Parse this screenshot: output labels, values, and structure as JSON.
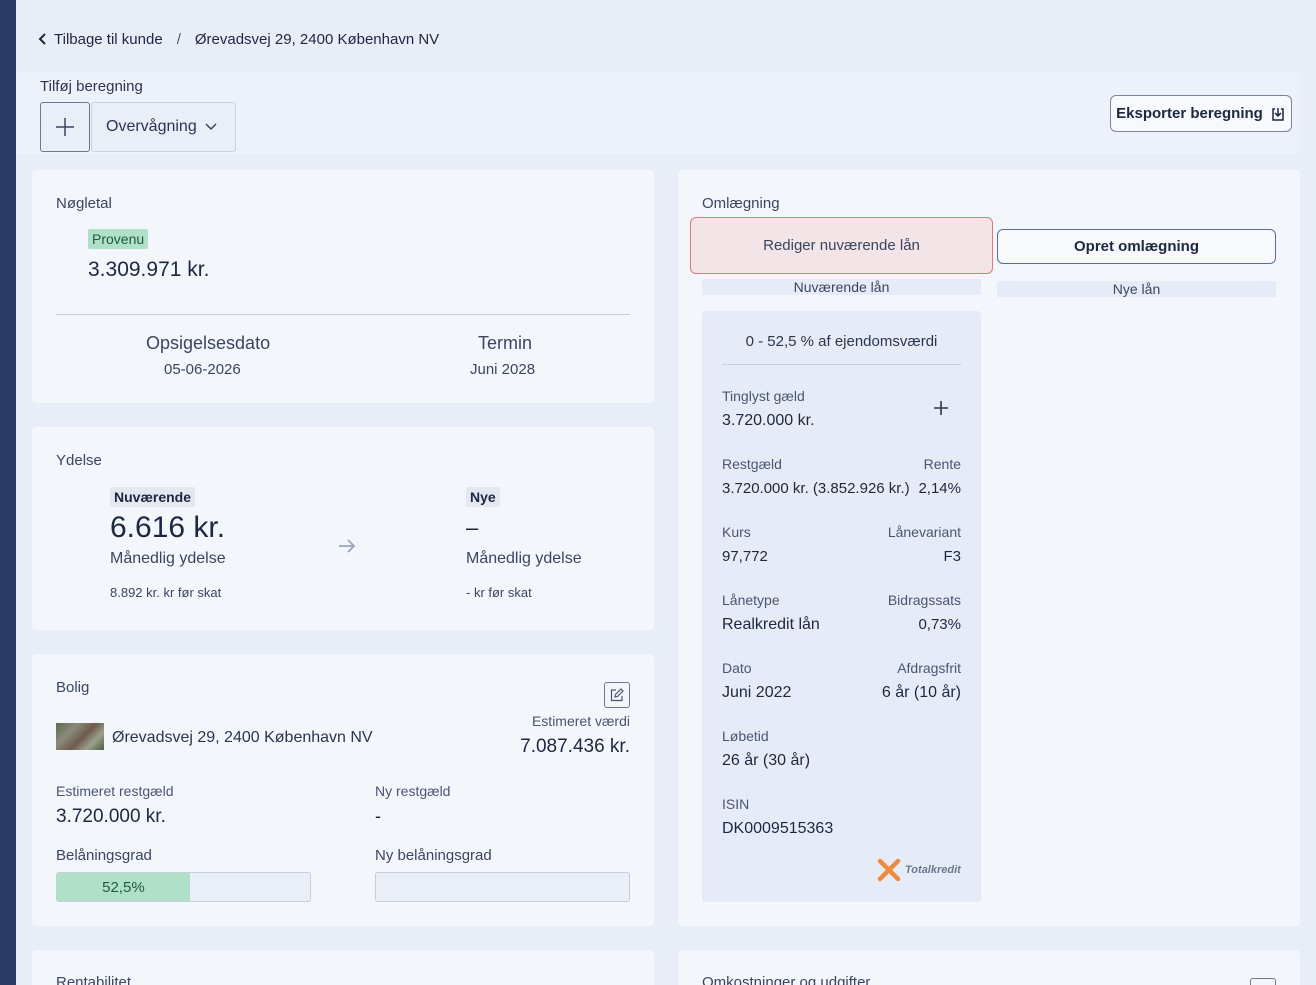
{
  "breadcrumb": {
    "back": "Tilbage til kunde",
    "separator": "/",
    "address": "Ørevadsvej 29, 2400 København NV"
  },
  "toolbar": {
    "add_label": "Tilføj beregning",
    "dropdown_value": "Overvågning",
    "export_label": "Eksporter beregning"
  },
  "noegletal": {
    "title": "Nøgletal",
    "badge": "Provenu",
    "amount": "3.309.971 kr.",
    "opsigelse_label": "Opsigelsesdato",
    "opsigelse_value": "05-06-2026",
    "termin_label": "Termin",
    "termin_value": "Juni 2028"
  },
  "ydelse": {
    "title": "Ydelse",
    "current_badge": "Nuværende",
    "current_amount": "6.616 kr.",
    "current_sub": "Månedlig ydelse",
    "current_pretax": "8.892 kr. kr før skat",
    "new_badge": "Nye",
    "new_amount": "–",
    "new_sub": "Månedlig ydelse",
    "new_pretax": "- kr før skat"
  },
  "bolig": {
    "title": "Bolig",
    "address": "Ørevadsvej 29, 2400 København NV",
    "est_value_label": "Estimeret værdi",
    "est_value": "7.087.436 kr.",
    "restgaeld_label": "Estimeret restgæld",
    "restgaeld_value": "3.720.000 kr.",
    "ny_restgaeld_label": "Ny restgæld",
    "ny_restgaeld_value": "-",
    "belaaning_label": "Belåningsgrad",
    "belaaning_value": "52,5%",
    "belaaning_fraction": 0.525,
    "ny_belaaning_label": "Ny belåningsgrad"
  },
  "rentabilitet": {
    "title": "Rentabilitet"
  },
  "omlaegning": {
    "title": "Omlægning",
    "edit_button": "Rediger nuværende lån",
    "create_button": "Opret omlægning",
    "current_tab": "Nuværende lån",
    "new_tab": "Nye lån"
  },
  "loan": {
    "range": "0 - 52,5 % af ejendomsværdi",
    "tinglyst_label": "Tinglyst gæld",
    "tinglyst_value": "3.720.000 kr.",
    "restgaeld_label": "Restgæld",
    "restgaeld_value": "3.720.000 kr. (3.852.926 kr.)",
    "rente_label": "Rente",
    "rente_value": "2,14%",
    "kurs_label": "Kurs",
    "kurs_value": "97,772",
    "laanevariant_label": "Lånevariant",
    "laanevariant_value": "F3",
    "laanetype_label": "Lånetype",
    "laanetype_value": "Realkredit lån",
    "bidrag_label": "Bidragssats",
    "bidrag_value": "0,73%",
    "dato_label": "Dato",
    "dato_value": "Juni 2022",
    "afdrag_label": "Afdragsfrit",
    "afdrag_value": "6 år (10 år)",
    "loebetid_label": "Løbetid",
    "loebetid_value": "26 år (30 år)",
    "isin_label": "ISIN",
    "isin_value": "DK0009515363",
    "lender": "Totalkredit"
  },
  "omkostninger": {
    "title": "Omkostninger og udgifter"
  },
  "colors": {
    "accent_navy": "#2a3a63",
    "green_badge": "#b0e0c8",
    "red_border": "#e07a80"
  }
}
